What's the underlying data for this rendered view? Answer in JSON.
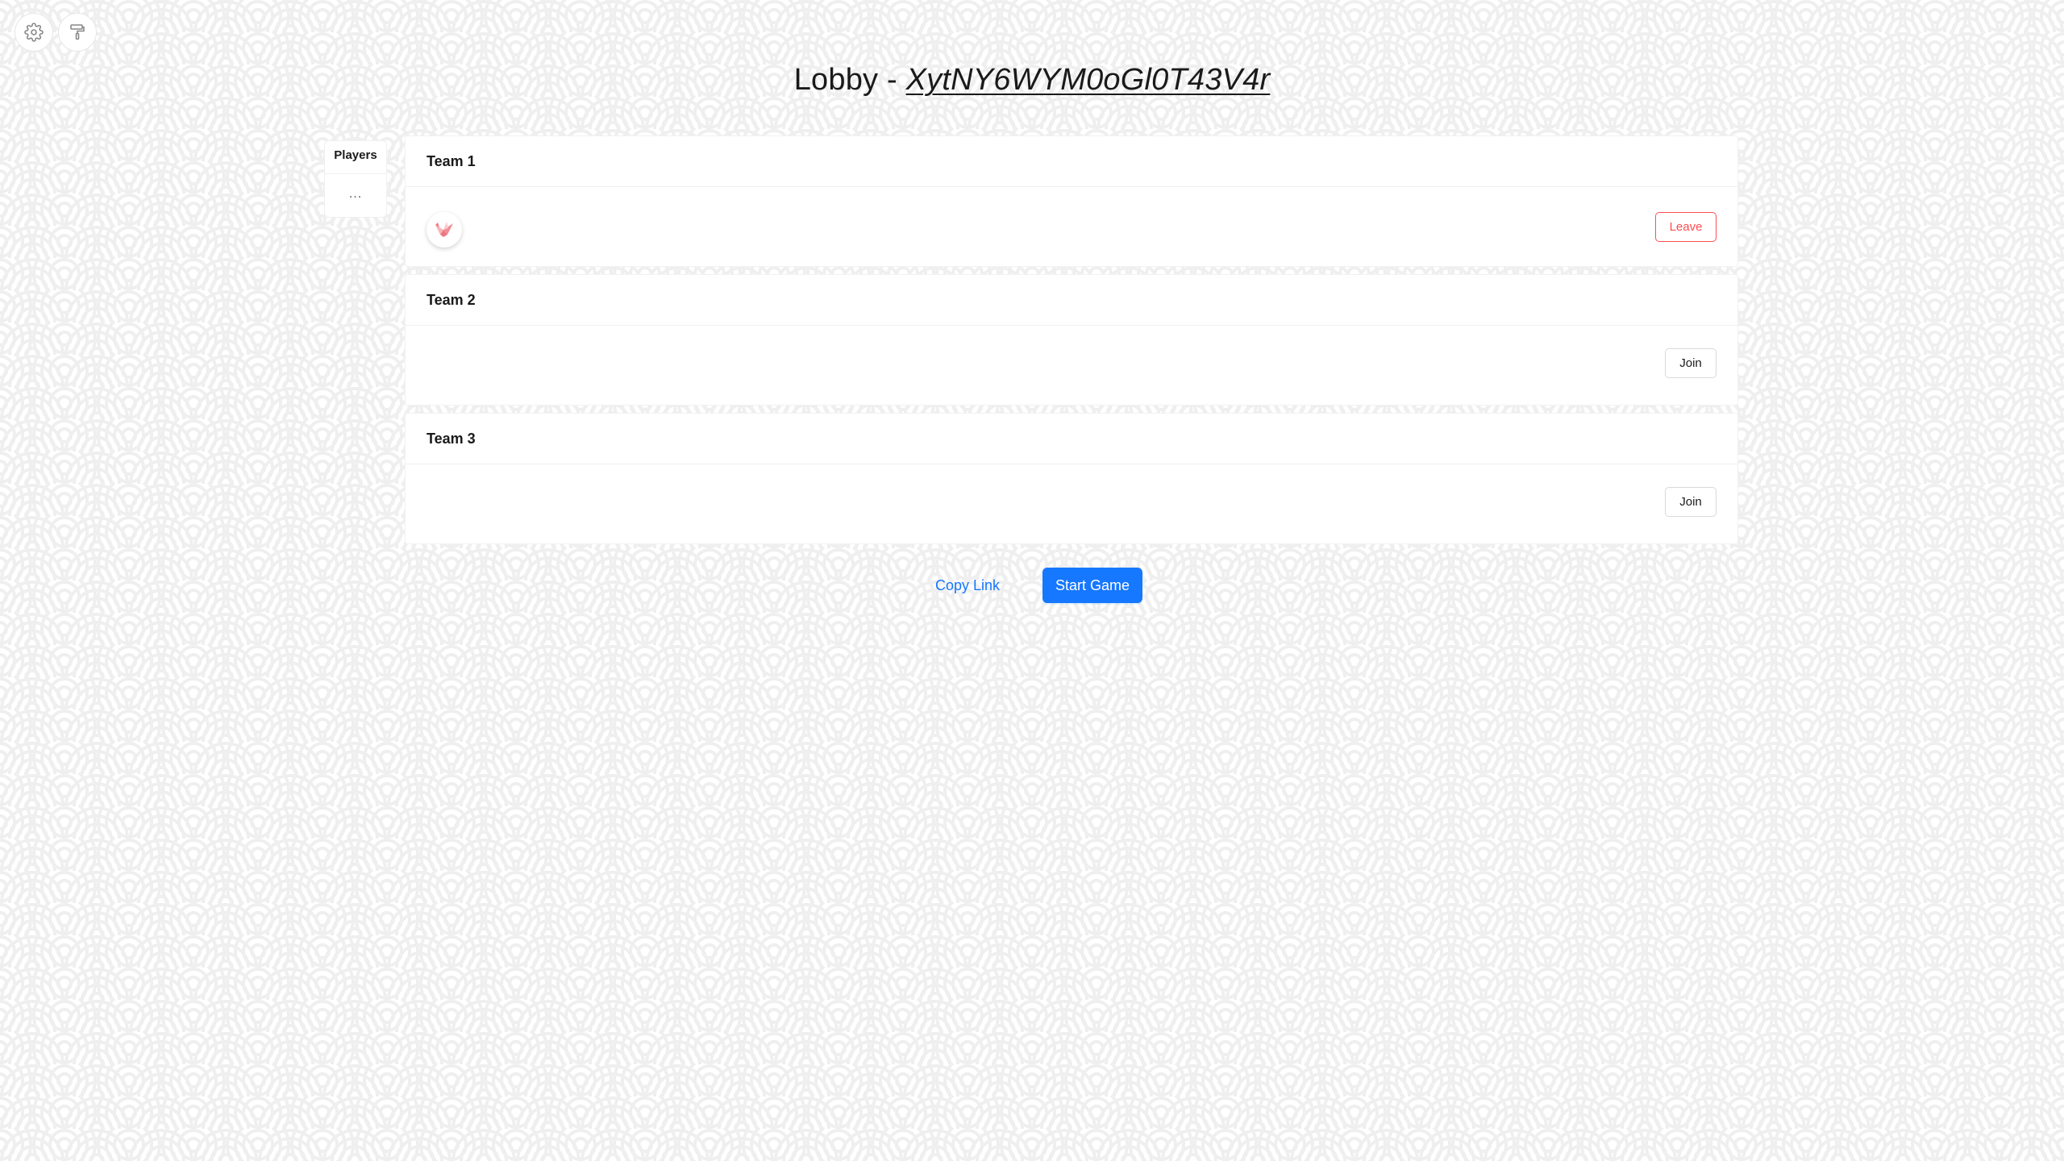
{
  "toolbar": {
    "settings_icon": "gear-icon",
    "theme_icon": "paint-roller-icon"
  },
  "header": {
    "prefix": "Lobby - ",
    "lobby_code": "XytNY6WYM0oGl0T43V4r"
  },
  "players_panel": {
    "title": "Players",
    "placeholder": "..."
  },
  "teams": [
    {
      "name": "Team 1",
      "members": [
        {
          "avatar_icon": "origami-crane-icon"
        }
      ],
      "action_label": "Leave"
    },
    {
      "name": "Team 2",
      "members": [],
      "action_label": "Join"
    },
    {
      "name": "Team 3",
      "members": [],
      "action_label": "Join"
    }
  ],
  "actions": {
    "copy_link": "Copy Link",
    "start_game": "Start Game"
  },
  "colors": {
    "primary": "#1677ff",
    "danger": "#ff4d4f",
    "pattern": "#ececec"
  }
}
